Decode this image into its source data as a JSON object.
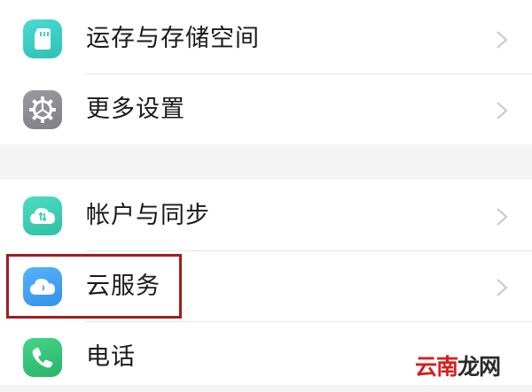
{
  "settings": {
    "rows": [
      {
        "label": "运存与存储空间",
        "icon": "storage-icon",
        "color": "#3fd0c4"
      },
      {
        "label": "更多设置",
        "icon": "gear-icon",
        "color": "#8e8e93"
      },
      {
        "label": "帐户与同步",
        "icon": "cloud-sync-icon",
        "color": "#3ecdb0"
      },
      {
        "label": "云服务",
        "icon": "cloud-icon",
        "color": "#3f9cf2"
      },
      {
        "label": "电话",
        "icon": "phone-icon",
        "color": "#35c67a"
      }
    ]
  },
  "annotation": {
    "highlight_target": "云服务",
    "highlight_color": "#a11d20"
  },
  "watermark": {
    "part_a": "云南",
    "part_b": "龙网"
  }
}
